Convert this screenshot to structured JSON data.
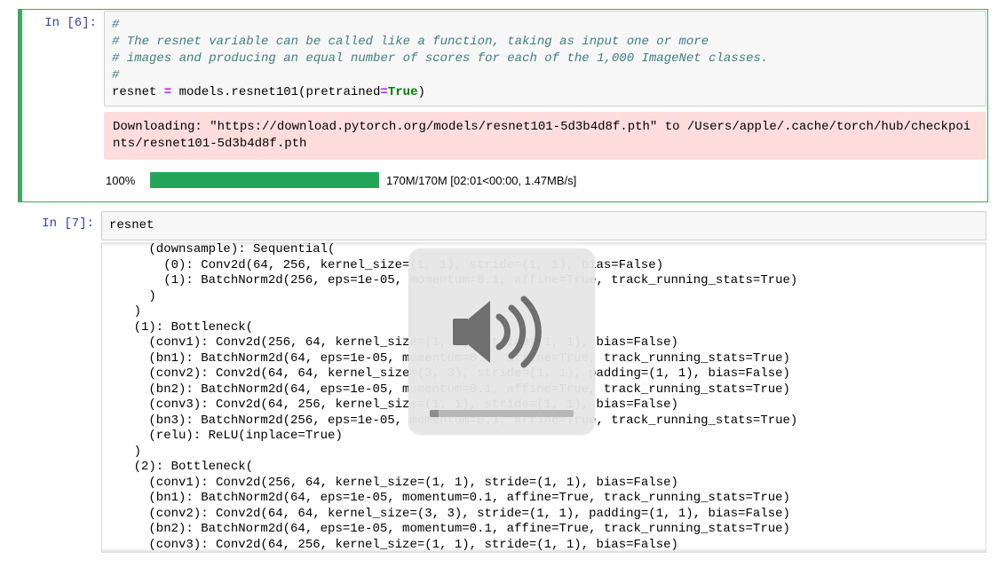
{
  "cell6": {
    "prompt": "In [6]:",
    "comment1": "#",
    "comment2": "# The resnet variable can be called like a function, taking as input one or more",
    "comment3": "# images and producing an equal number of scores for each of the 1,000 ImageNet classes.",
    "comment4": "#",
    "code_lhs": "resnet ",
    "code_eq": "=",
    "code_mid": " models.resnet101(pretrained",
    "code_eq2": "=",
    "code_true": "True",
    "code_end": ")",
    "stderr": "Downloading: \"https://download.pytorch.org/models/resnet101-5d3b4d8f.pth\" to /Users/apple/.cache/torch/hub/checkpoints/resnet101-5d3b4d8f.pth",
    "progress_pct": "100%",
    "progress_text": "170M/170M [02:01<00:00, 1.47MB/s]"
  },
  "cell7": {
    "prompt": "In [7]:",
    "code": "resnet",
    "output_lines": [
      "      (downsample): Sequential(",
      "        (0): Conv2d(64, 256, kernel_size=(1, 1), stride=(1, 1), bias=False)",
      "        (1): BatchNorm2d(256, eps=1e-05, momentum=0.1, affine=True, track_running_stats=True)",
      "      )",
      "    )",
      "    (1): Bottleneck(",
      "      (conv1): Conv2d(256, 64, kernel_size=(1, 1), stride=(1, 1), bias=False)",
      "      (bn1): BatchNorm2d(64, eps=1e-05, momentum=0.1, affine=True, track_running_stats=True)",
      "      (conv2): Conv2d(64, 64, kernel_size=(3, 3), stride=(1, 1), padding=(1, 1), bias=False)",
      "      (bn2): BatchNorm2d(64, eps=1e-05, momentum=0.1, affine=True, track_running_stats=True)",
      "      (conv3): Conv2d(64, 256, kernel_size=(1, 1), stride=(1, 1), bias=False)",
      "      (bn3): BatchNorm2d(256, eps=1e-05, momentum=0.1, affine=True, track_running_stats=True)",
      "      (relu): ReLU(inplace=True)",
      "    )",
      "    (2): Bottleneck(",
      "      (conv1): Conv2d(256, 64, kernel_size=(1, 1), stride=(1, 1), bias=False)",
      "      (bn1): BatchNorm2d(64, eps=1e-05, momentum=0.1, affine=True, track_running_stats=True)",
      "      (conv2): Conv2d(64, 64, kernel_size=(3, 3), stride=(1, 1), padding=(1, 1), bias=False)",
      "      (bn2): BatchNorm2d(64, eps=1e-05, momentum=0.1, affine=True, track_running_stats=True)",
      "      (conv3): Conv2d(64, 256, kernel_size=(1, 1), stride=(1, 1), bias=False)"
    ]
  },
  "volume": {
    "level_pct": 6
  }
}
